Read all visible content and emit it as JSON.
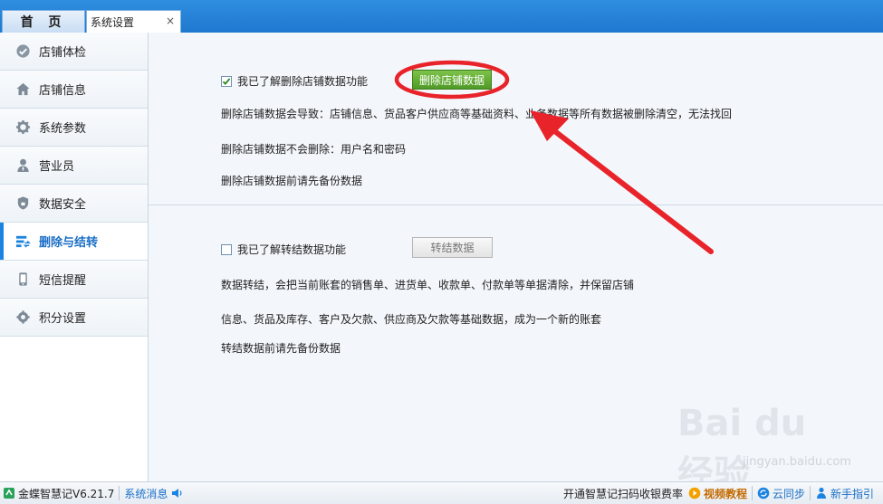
{
  "tabs": {
    "home": "首 页",
    "settings": "系统设置",
    "close_glyph": "×"
  },
  "sidebar": {
    "items": [
      {
        "label": "店铺体检",
        "icon": "check-circle-icon"
      },
      {
        "label": "店铺信息",
        "icon": "house-icon"
      },
      {
        "label": "系统参数",
        "icon": "gear-icon"
      },
      {
        "label": "营业员",
        "icon": "user-icon"
      },
      {
        "label": "数据安全",
        "icon": "shield-icon"
      },
      {
        "label": "删除与结转",
        "icon": "transfer-icon",
        "active": true
      },
      {
        "label": "短信提醒",
        "icon": "phone-icon"
      },
      {
        "label": "积分设置",
        "icon": "cog-small-icon"
      }
    ]
  },
  "delete_section": {
    "checkbox_label": "我已了解删除店铺数据功能",
    "checked": true,
    "button_label": "删除店铺数据",
    "line1": "删除店铺数据会导致：店铺信息、货品客户供应商等基础资料、业务数据等所有数据被删除清空，无法找回",
    "line2": "删除店铺数据不会删除：用户名和密码",
    "line3": "删除店铺数据前请先备份数据"
  },
  "transfer_section": {
    "checkbox_label": "我已了解转结数据功能",
    "checked": false,
    "button_label": "转结数据",
    "line1": "数据转结，会把当前账套的销售单、进货单、收款单、付款单等单据清除，并保留店铺",
    "line2": "信息、货品及库存、客户及欠款、供应商及欠款等基础数据，成为一个新的账套",
    "line3": "转结数据前请先备份数据"
  },
  "statusbar": {
    "app_version": "金蝶智慧记V6.21.7",
    "messages": "系统消息",
    "promo": "开通智慧记扫码收银费率",
    "video": "视频教程",
    "sync": "云同步",
    "guide": "新手指引"
  },
  "colors": {
    "accent": "#1b83e0",
    "green_button": "#5fa82f",
    "annotation_red": "#e8232a"
  },
  "watermark": {
    "main": "Bai du 经验",
    "sub": "jingyan.baidu.com"
  }
}
